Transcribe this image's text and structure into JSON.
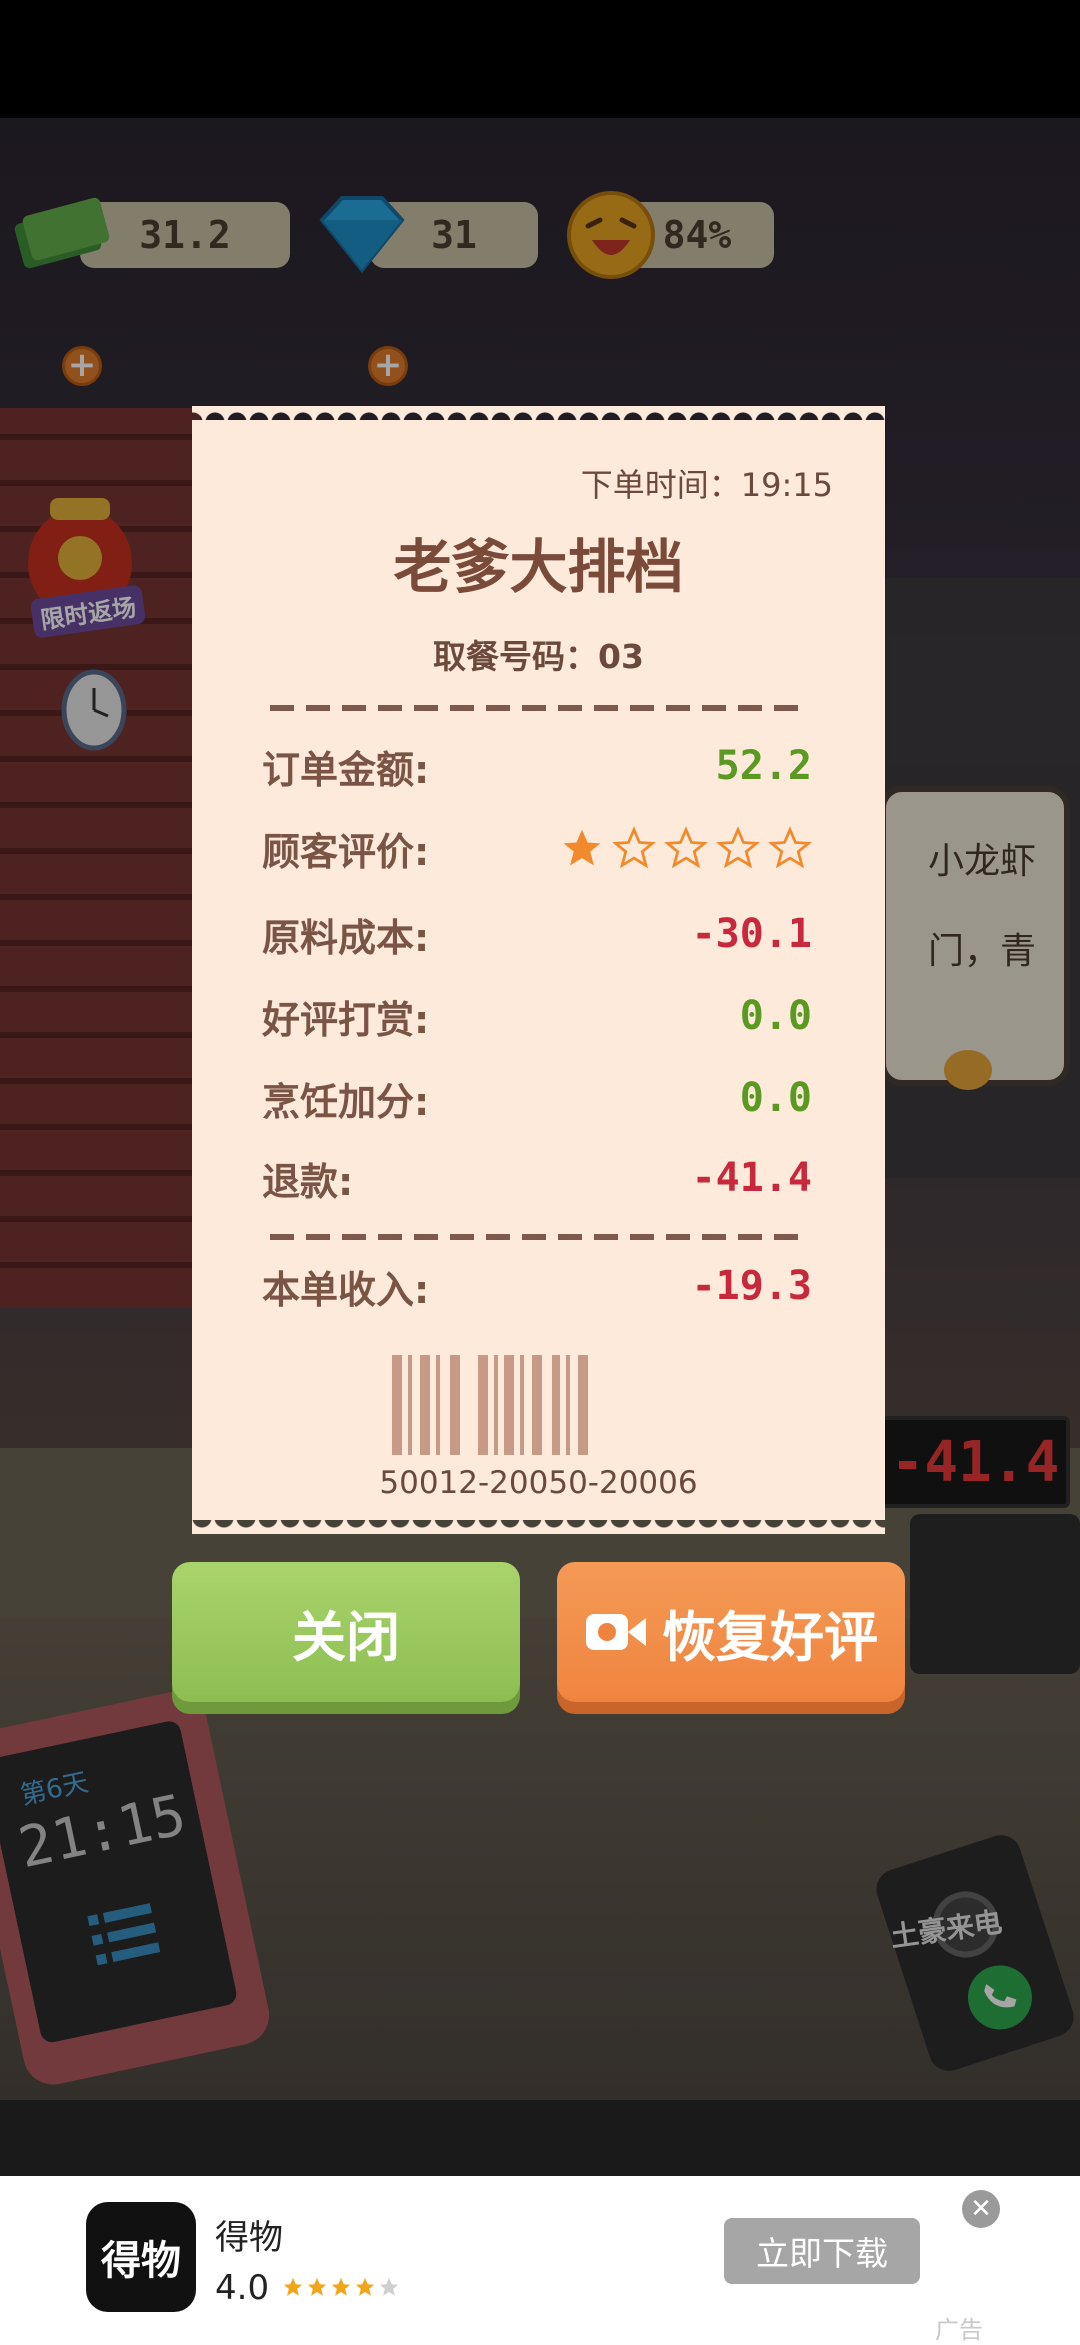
{
  "hud": {
    "cash": "31.2",
    "gems": "31",
    "satisfaction": "84%"
  },
  "event_badge": "限时返场",
  "sign_lines": [
    "小龙虾",
    "门，青"
  ],
  "scoreboard": "-41.4",
  "receipt": {
    "order_time": "下单时间：19:15",
    "shop_name": "老爹大排档",
    "pickup_code": "取餐号码：03",
    "rows": [
      {
        "label": "订单金额:",
        "value": "52.2",
        "color": "#5a9a23"
      },
      {
        "label": "顾客评价:",
        "rating": 1,
        "max": 5
      },
      {
        "label": "原料成本:",
        "value": "-30.1",
        "color": "#c8283c"
      },
      {
        "label": "好评打赏:",
        "value": "0.0",
        "color": "#5a9a23"
      },
      {
        "label": "烹饪加分:",
        "value": "0.0",
        "color": "#5a9a23"
      },
      {
        "label": "退款:",
        "value": "-41.4",
        "color": "#c8283c"
      }
    ],
    "total": {
      "label": "本单收入:",
      "value": "-19.3",
      "color": "#c8283c"
    },
    "barcode_number": "50012-20050-20006"
  },
  "buttons": {
    "close": "关闭",
    "restore": "恢复好评"
  },
  "tablet": {
    "day": "第6天",
    "clock": "21:15"
  },
  "phone_label": "土豪来电",
  "ad": {
    "app_name": "得物",
    "logo_text": "得物",
    "rating": "4.0",
    "stars": 4,
    "download": "立即下载",
    "tag": "广告"
  }
}
